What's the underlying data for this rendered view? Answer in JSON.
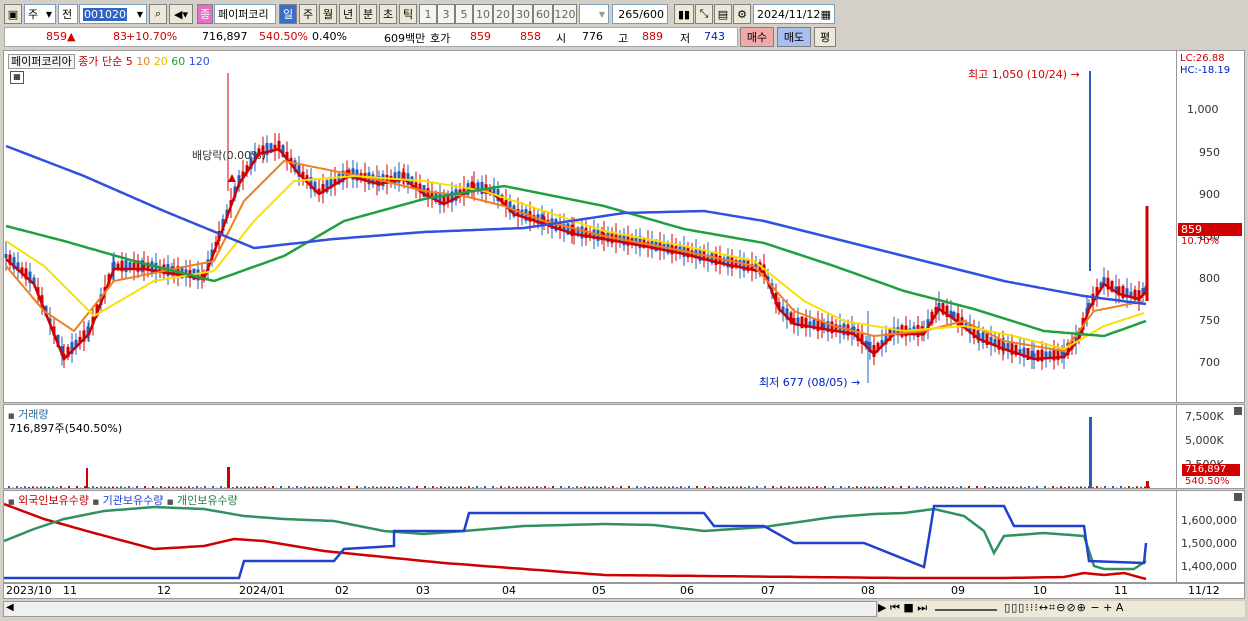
{
  "toolbar": {
    "market": "주",
    "prev_label": "전",
    "code": "001020",
    "badge": "종",
    "name": "페이퍼코리",
    "periods": [
      "일",
      "주",
      "월",
      "년",
      "분",
      "초",
      "틱"
    ],
    "numbers": [
      "1",
      "3",
      "5",
      "10",
      "20",
      "30",
      "60",
      "120"
    ],
    "count": "265",
    "count_total": "/600",
    "date": "2024/11/12"
  },
  "quote": {
    "price": "859",
    "change": "83",
    "change_pct": "+10.70%",
    "volume": "716,897",
    "vol_ratio": "540.50%",
    "turnover": "0.40%",
    "amount": "609백만",
    "ask_label": "호가",
    "ask1": "859",
    "ask2": "858",
    "open_label": "시",
    "open": "776",
    "high_label": "고",
    "high": "889",
    "low_label": "저",
    "low": "743",
    "buy": "매수",
    "sell": "매도",
    "eval": "평"
  },
  "price_panel": {
    "name": "페이퍼코리아",
    "indicator": "종가 단순",
    "ma": [
      "5",
      "10",
      "20",
      "60",
      "120"
    ],
    "ma_colors": [
      "#d00000",
      "#f08020",
      "#f8e000",
      "#20a040",
      "#3050e0"
    ],
    "lc": "LC:26.88",
    "hc": "HC:-18.19",
    "high_note": "최고 1,050 (10/24)",
    "low_note": "최저 677 (08/05)",
    "dividend_note": "배당락(0.00%)",
    "price_tag": "859",
    "pct_tag": "10.70%",
    "yticks": [
      "1,000",
      "950",
      "900",
      "850",
      "800",
      "750",
      "700"
    ]
  },
  "volume_panel": {
    "title": "거래량",
    "value": "716,897주(540.50%)",
    "yticks": [
      "7,500K",
      "5,000K",
      "2,500K"
    ],
    "tag1": "716,897",
    "tag2": "540.50%"
  },
  "holdings_panel": {
    "series": [
      "외국인보유수량",
      "기관보유수량",
      "개인보유수량"
    ],
    "yticks": [
      "1,600,000",
      "1,500,000",
      "1,400,000"
    ]
  },
  "xaxis": {
    "labels": [
      "2023/10",
      "11",
      "12",
      "2024/01",
      "02",
      "03",
      "04",
      "05",
      "06",
      "07",
      "08",
      "09",
      "10",
      "11"
    ],
    "right_label": "11/12"
  }
}
